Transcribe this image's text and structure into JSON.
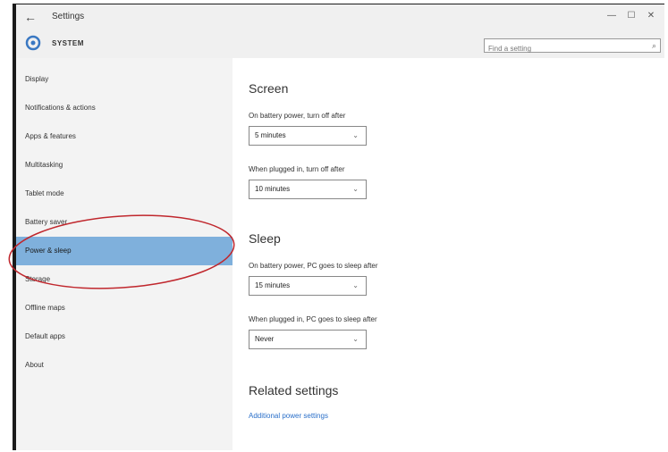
{
  "titlebar": {
    "title": "Settings",
    "back_glyph": "←",
    "controls": [
      "—",
      "☐",
      "✕"
    ]
  },
  "header": {
    "section": "SYSTEM",
    "icon": "gear-icon",
    "search_placeholder": "Find a setting",
    "search_icon": "search-icon"
  },
  "sidebar": {
    "items": [
      {
        "label": "Display",
        "active": false
      },
      {
        "label": "Notifications & actions",
        "active": false
      },
      {
        "label": "Apps & features",
        "active": false
      },
      {
        "label": "Multitasking",
        "active": false
      },
      {
        "label": "Tablet mode",
        "active": false
      },
      {
        "label": "Battery saver",
        "active": false
      },
      {
        "label": "Power & sleep",
        "active": true
      },
      {
        "label": "Storage",
        "active": false
      },
      {
        "label": "Offline maps",
        "active": false
      },
      {
        "label": "Default apps",
        "active": false
      },
      {
        "label": "About",
        "active": false
      }
    ]
  },
  "main": {
    "screen": {
      "heading": "Screen",
      "battery_label": "On battery power, turn off after",
      "battery_value": "5 minutes",
      "plugged_label": "When plugged in, turn off after",
      "plugged_value": "10 minutes"
    },
    "sleep": {
      "heading": "Sleep",
      "battery_label": "On battery power, PC goes to sleep after",
      "battery_value": "15 minutes",
      "plugged_label": "When plugged in, PC goes to sleep after",
      "plugged_value": "Never"
    },
    "related": {
      "heading": "Related settings",
      "link": "Additional power settings"
    }
  },
  "colors": {
    "active_item": "#7fb0dc",
    "link": "#2a6fc9",
    "annotation": "#c0272d"
  }
}
